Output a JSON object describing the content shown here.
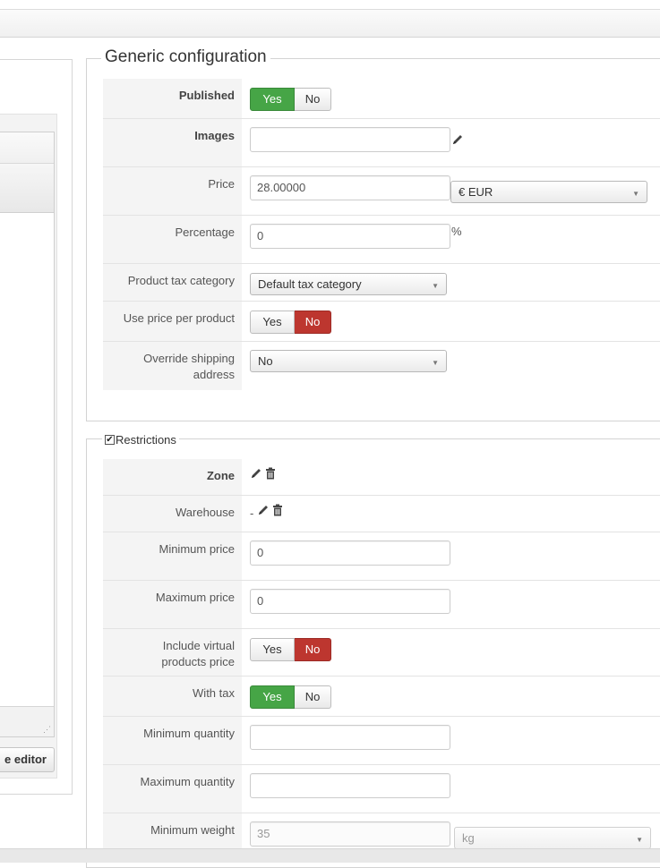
{
  "left_panel": {
    "editor_button_label": "e editor"
  },
  "generic": {
    "legend": "Generic configuration",
    "published": {
      "label": "Published",
      "yes": "Yes",
      "no": "No",
      "selected": "Yes"
    },
    "images": {
      "label": "Images",
      "value": ""
    },
    "price": {
      "label": "Price",
      "value": "28.00000",
      "currency": "€ EUR"
    },
    "percentage": {
      "label": "Percentage",
      "value": "0",
      "unit": "%"
    },
    "tax_category": {
      "label": "Product tax category",
      "value": "Default tax category"
    },
    "price_per_product": {
      "label": "Use price per product",
      "yes": "Yes",
      "no": "No",
      "selected": "No"
    },
    "override_shipping": {
      "label": "Override shipping address",
      "value": "No"
    }
  },
  "restrictions": {
    "legend": "Restrictions",
    "checked": true,
    "zone": {
      "label": "Zone"
    },
    "warehouse": {
      "label": "Warehouse",
      "value": "-"
    },
    "min_price": {
      "label": "Minimum price",
      "value": "0"
    },
    "max_price": {
      "label": "Maximum price",
      "value": "0"
    },
    "include_virtual": {
      "label": "Include virtual products price",
      "yes": "Yes",
      "no": "No",
      "selected": "No"
    },
    "with_tax": {
      "label": "With tax",
      "yes": "Yes",
      "no": "No",
      "selected": "Yes"
    },
    "min_quantity": {
      "label": "Minimum quantity",
      "value": ""
    },
    "max_quantity": {
      "label": "Maximum quantity",
      "value": ""
    },
    "min_weight": {
      "label": "Minimum weight",
      "value": "35",
      "unit": "kg"
    }
  },
  "colors": {
    "toggle_yes_active": "#46a546",
    "toggle_no_active": "#bd362f"
  }
}
